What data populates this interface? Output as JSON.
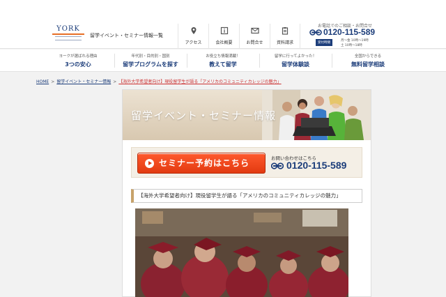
{
  "header": {
    "logo_text": "YORK",
    "site_desc": "留学イベント・セミナー情報一覧",
    "nav": [
      {
        "label": "アクセス",
        "icon": "map-pin-icon"
      },
      {
        "label": "会社概要",
        "icon": "info-icon"
      },
      {
        "label": "お問合せ",
        "icon": "envelope-icon"
      },
      {
        "label": "資料請求",
        "icon": "clipboard-icon"
      }
    ],
    "contact": {
      "note": "お電話でのご相談・お問合せ",
      "phone": "0120-115-589",
      "hours_badge": "受付時間",
      "hours_line1": "月〜金 10時〜19時",
      "hours_line2": "土 10時〜18時"
    }
  },
  "mainnav": [
    {
      "sub": "ヨークが選ばれる理由",
      "main": "3つの安心"
    },
    {
      "sub": "年代別・目的別・国別",
      "main": "留学プログラムを探す"
    },
    {
      "sub": "お役立ち情報満載！",
      "main": "教えて留学"
    },
    {
      "sub": "留学に行ってよかった！",
      "main": "留学体験談"
    },
    {
      "sub": "全国からできる",
      "main": "無料留学相談"
    }
  ],
  "breadcrumb": {
    "home": "HOME",
    "events": "留学イベント・セミナー情報",
    "current": "【海外大学希望者向け】現役留学生が語る「アメリカのコミュニティカレッジの魅力」",
    "separator": ">"
  },
  "content": {
    "banner_title": "留学イベント・セミナー情報",
    "reserve_button": "セミナー予約はこちら",
    "inquiry_label": "お問い合わせはこちら",
    "inquiry_phone": "0120-115-589",
    "event_title": "【海外大学希望者向け】現役留学生が語る「アメリカのコミュニティカレッジの魅力」"
  },
  "colors": {
    "brand_navy": "#1c3d7a",
    "accent_orange": "#e23a10",
    "banner_beige": "#ece2d2"
  }
}
